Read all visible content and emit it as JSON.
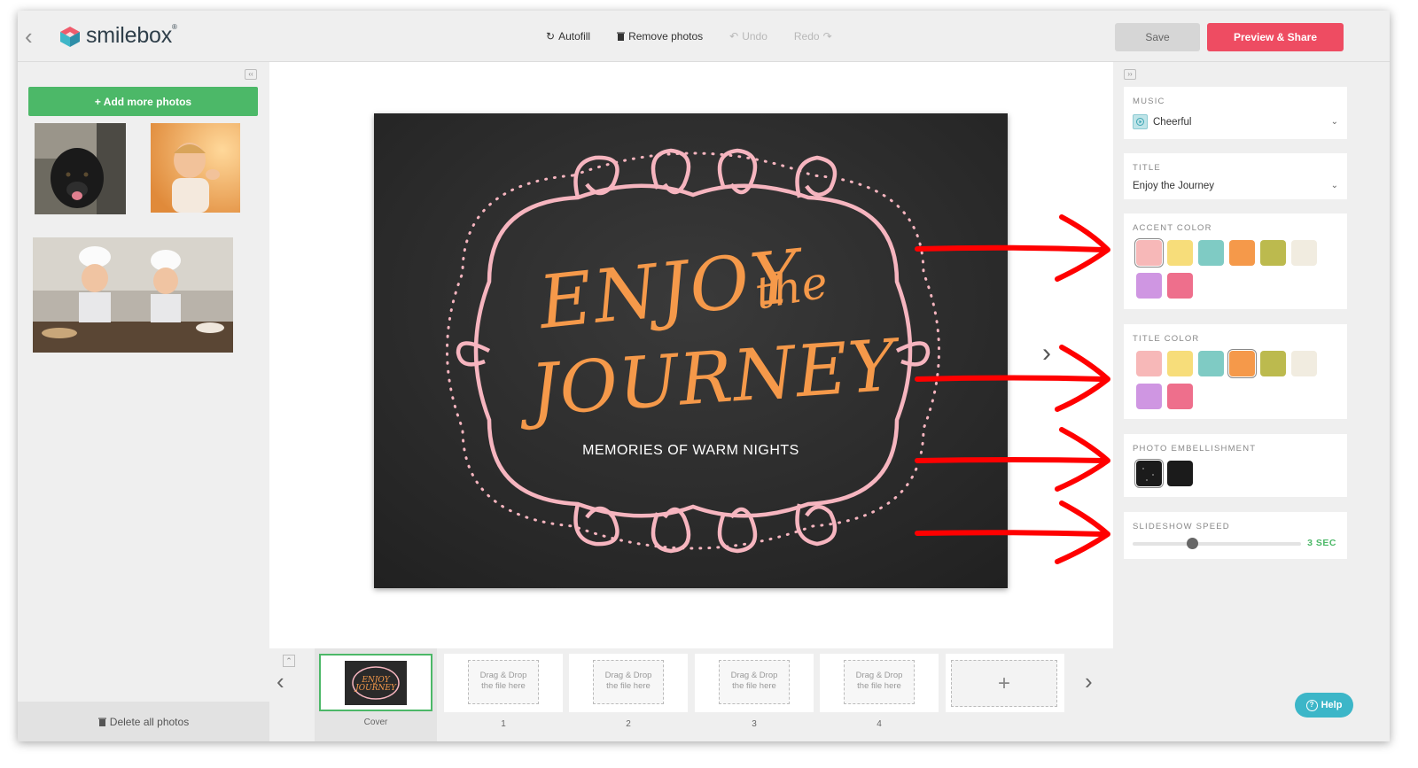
{
  "app": {
    "brand": "smilebox"
  },
  "toolbar": {
    "autofill": "Autofill",
    "remove_photos": "Remove photos",
    "undo": "Undo",
    "redo": "Redo",
    "save": "Save",
    "preview_share": "Preview & Share"
  },
  "left": {
    "add_photos": "+ Add more photos",
    "delete_all": "Delete all photos"
  },
  "slide": {
    "title_line1": "ENJOY",
    "title_the": "the",
    "title_line2": "JOURNEY",
    "subtitle": "MEMORIES OF WARM NIGHTS"
  },
  "filmstrip": {
    "cover_label": "Cover",
    "drop_text_1": "Drag & Drop",
    "drop_text_2": "the file here",
    "slots": [
      {
        "number": "1"
      },
      {
        "number": "2"
      },
      {
        "number": "3"
      },
      {
        "number": "4"
      }
    ],
    "add_symbol": "+"
  },
  "right": {
    "music": {
      "label": "MUSIC",
      "value": "Cheerful"
    },
    "title": {
      "label": "TITLE",
      "value": "Enjoy the Journey"
    },
    "accent": {
      "label": "ACCENT COLOR",
      "selected": 0
    },
    "title_color": {
      "label": "TITLE COLOR",
      "selected": 3
    },
    "embellishment": {
      "label": "PHOTO EMBELLISHMENT"
    },
    "speed": {
      "label": "SLIDESHOW SPEED",
      "value": "3 SEC",
      "fraction": 0.35
    },
    "swatches": [
      "#f7b8b8",
      "#f7dd7a",
      "#7fcbc4",
      "#f5994a",
      "#bcba4e",
      "#f1ece0",
      "#cf96e2",
      "#ee6f8c"
    ],
    "help": "Help"
  },
  "colors": {
    "accent_green": "#4cb868",
    "brand_red": "#ee4c62",
    "chalk_pink": "#f6b5bf",
    "title_orange": "#f5994a",
    "annotation_red": "#ff0000"
  }
}
